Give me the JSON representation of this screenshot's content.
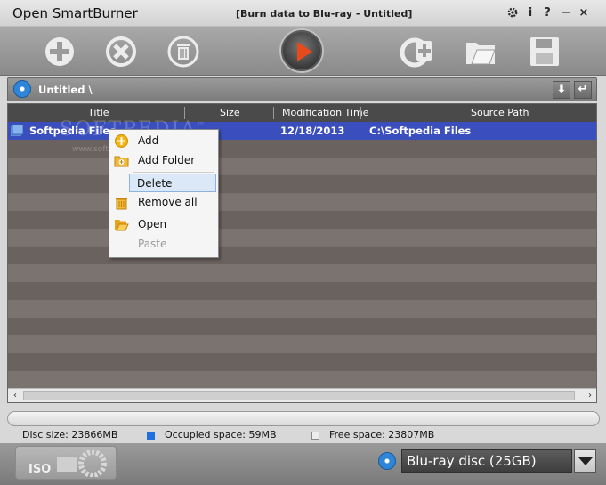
{
  "window": {
    "app_title": "Open SmartBurner",
    "doc_title": "[Burn data to Blu-ray - Untitled]",
    "icons": [
      "gear-icon",
      "info-icon",
      "help-icon",
      "minimize-icon",
      "close-icon"
    ],
    "icon_glyphs": {
      "info": "i",
      "help": "?",
      "minimize": "−",
      "close": "×"
    }
  },
  "toolbar": {
    "items": [
      "add-icon",
      "remove-icon",
      "trash-icon",
      "burn-play-icon",
      "add-disc-icon",
      "open-folder-icon",
      "save-icon"
    ]
  },
  "pathbar": {
    "path": "Untitled \\",
    "down_glyph": "⬇",
    "back_glyph": "↵"
  },
  "table": {
    "columns": [
      "Title",
      "Size",
      "Modification Time",
      "Source Path"
    ],
    "rows": [
      {
        "title": "Softpedia Files",
        "size": "",
        "modified": "12/18/2013",
        "source": "C:\\Softpedia Files"
      }
    ],
    "watermark": "SOFTPEDIA",
    "watermark_sub": "www.softpedia.com",
    "watermark_mark": "™"
  },
  "context_menu": {
    "items": [
      {
        "label": "Add",
        "icon": "add-icon",
        "enabled": true
      },
      {
        "label": "Add Folder",
        "icon": "add-folder-icon",
        "enabled": true
      },
      {
        "label": "Delete",
        "icon": "",
        "enabled": true,
        "highlighted": true
      },
      {
        "label": "Remove all",
        "icon": "trash-icon",
        "enabled": true
      },
      {
        "label": "Open",
        "icon": "open-folder-icon",
        "enabled": true
      },
      {
        "label": "Paste",
        "icon": "",
        "enabled": false
      }
    ]
  },
  "status": {
    "disc_size": "Disc size: 23866MB",
    "occupied": "Occupied space: 59MB",
    "free": "Free space: 23807MB",
    "occupied_color": "#1f6fe0",
    "free_color": "#ededed"
  },
  "bottom": {
    "iso_label": "ISO",
    "disc_type": "Blu-ray disc (25GB)"
  },
  "scroll": {
    "left": "‹",
    "right": "›"
  },
  "colors": {
    "selection": "#3a4fbd",
    "stripe_dark": "#6a625f",
    "stripe_light": "#7b7370",
    "accent_play": "#e94a1c"
  }
}
